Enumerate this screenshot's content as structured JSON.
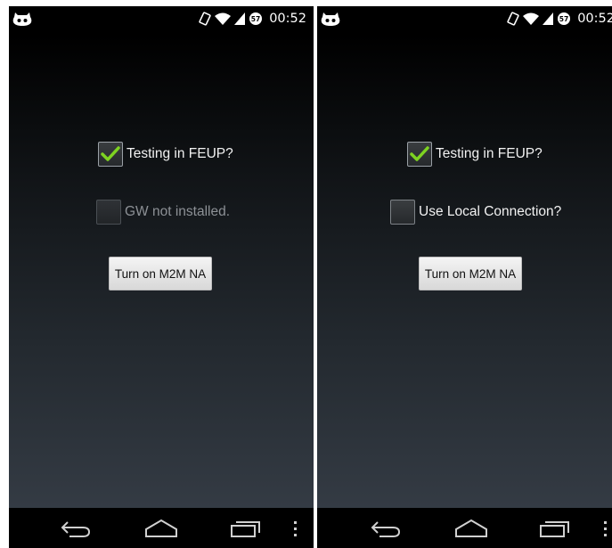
{
  "screens": [
    {
      "status": {
        "clock": "00:52",
        "battery_level": "57"
      },
      "checkbox1": {
        "label": "Testing in FEUP?",
        "checked": true,
        "enabled": true
      },
      "checkbox2": {
        "label": "GW not installed.",
        "checked": false,
        "enabled": false
      },
      "button": {
        "label": "Turn on M2M NA"
      }
    },
    {
      "status": {
        "clock": "00:52",
        "battery_level": "57"
      },
      "checkbox1": {
        "label": "Testing in FEUP?",
        "checked": true,
        "enabled": true
      },
      "checkbox2": {
        "label": "Use Local Connection?",
        "checked": false,
        "enabled": true
      },
      "button": {
        "label": "Turn on M2M NA"
      }
    }
  ],
  "colors": {
    "check_green": "#7ed321",
    "button_bg": "#e6e6e6",
    "label_text": "#f2f2f2",
    "disabled_text": "#8d9196"
  },
  "icons": [
    "cyanogenmod-icon",
    "vibrate-icon",
    "wifi-icon",
    "signal-icon",
    "battery-icon",
    "back-icon",
    "home-icon",
    "recents-icon",
    "menu-icon"
  ]
}
